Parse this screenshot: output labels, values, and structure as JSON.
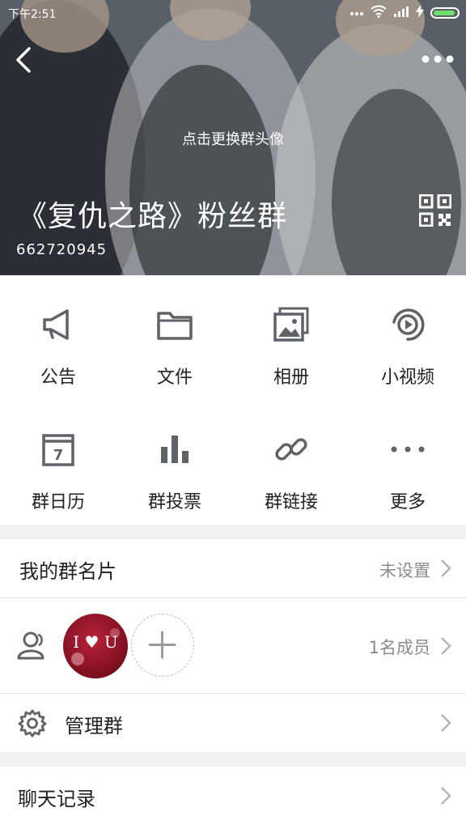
{
  "status_bar": {
    "time": "下午2:51"
  },
  "header": {
    "change_avatar_text": "点击更换群头像",
    "group_name": "《复仇之路》粉丝群",
    "group_id": "662720945"
  },
  "features": [
    {
      "label": "公告",
      "icon": "megaphone-icon"
    },
    {
      "label": "文件",
      "icon": "folder-icon"
    },
    {
      "label": "相册",
      "icon": "photo-album-icon"
    },
    {
      "label": "小视频",
      "icon": "video-icon"
    },
    {
      "label": "群日历",
      "icon": "calendar-icon"
    },
    {
      "label": "群投票",
      "icon": "bar-chart-icon"
    },
    {
      "label": "群链接",
      "icon": "link-icon"
    },
    {
      "label": "更多",
      "icon": "more-dots-icon"
    }
  ],
  "calendar_day": "7",
  "card_row": {
    "label": "我的群名片",
    "value": "未设置"
  },
  "members_row": {
    "count_text": "1名成员",
    "avatar_text": "I ♥ U"
  },
  "manage_row": {
    "label": "管理群"
  },
  "chat_row": {
    "label": "聊天记录"
  },
  "colors": {
    "icon_gray": "#5f6368",
    "header_overlay": "#5a626d",
    "chevron": "#b5b5b5"
  }
}
